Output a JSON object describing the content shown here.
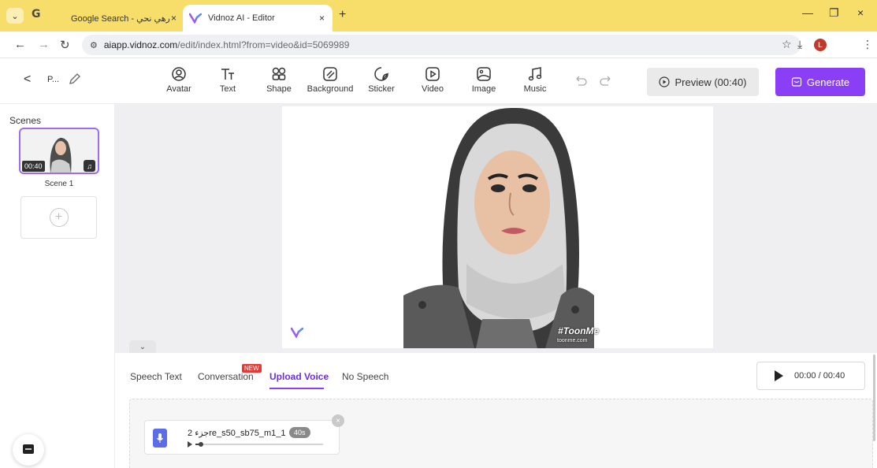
{
  "browser": {
    "tabs": [
      {
        "label": "Google Search - رهي نحي",
        "active": false
      },
      {
        "label": "Vidnoz AI - Editor",
        "active": true
      }
    ],
    "tab_menu": "⌄",
    "google_glyph": "G",
    "new_tab": "+",
    "url_host": "aiapp.vidnoz.com",
    "url_path": "/edit/index.html?from=video&id=5069989",
    "profile_initial": "L",
    "close_glyph": "×"
  },
  "toolbar": {
    "project_name": "P...",
    "tools": [
      {
        "label": "Avatar",
        "icon": "avatar-icon"
      },
      {
        "label": "Text",
        "icon": "text-icon"
      },
      {
        "label": "Shape",
        "icon": "shape-icon"
      },
      {
        "label": "Background",
        "icon": "background-icon"
      },
      {
        "label": "Sticker",
        "icon": "sticker-icon"
      },
      {
        "label": "Video",
        "icon": "video-icon"
      },
      {
        "label": "Image",
        "icon": "image-icon"
      },
      {
        "label": "Music",
        "icon": "music-icon"
      }
    ],
    "preview_label": "Preview (00:40)",
    "generate_label": "Generate"
  },
  "scenes": {
    "title": "Scenes",
    "items": [
      {
        "label": "Scene 1",
        "duration": "00:40"
      }
    ],
    "add_glyph": "+"
  },
  "canvas": {
    "watermark": "#ToonMe",
    "watermark_sub": "toonme.com",
    "collapse_glyph": "⌄"
  },
  "bottom_panel": {
    "tabs": [
      {
        "label": "Speech Text",
        "active": false
      },
      {
        "label": "Conversation",
        "active": false
      },
      {
        "label": "Upload Voice",
        "active": true
      },
      {
        "label": "No Speech",
        "active": false
      }
    ],
    "new_badge": "NEW",
    "playback_time": "00:00 / 00:40",
    "voice_file": {
      "name": "2 جزءre_s50_sb75_m1_1",
      "duration": "40s",
      "progress": 0.03
    }
  },
  "colors": {
    "accent": "#8a3ff7",
    "chrome_bar": "#f7de6a",
    "canvas_bg": "#efeff1"
  }
}
